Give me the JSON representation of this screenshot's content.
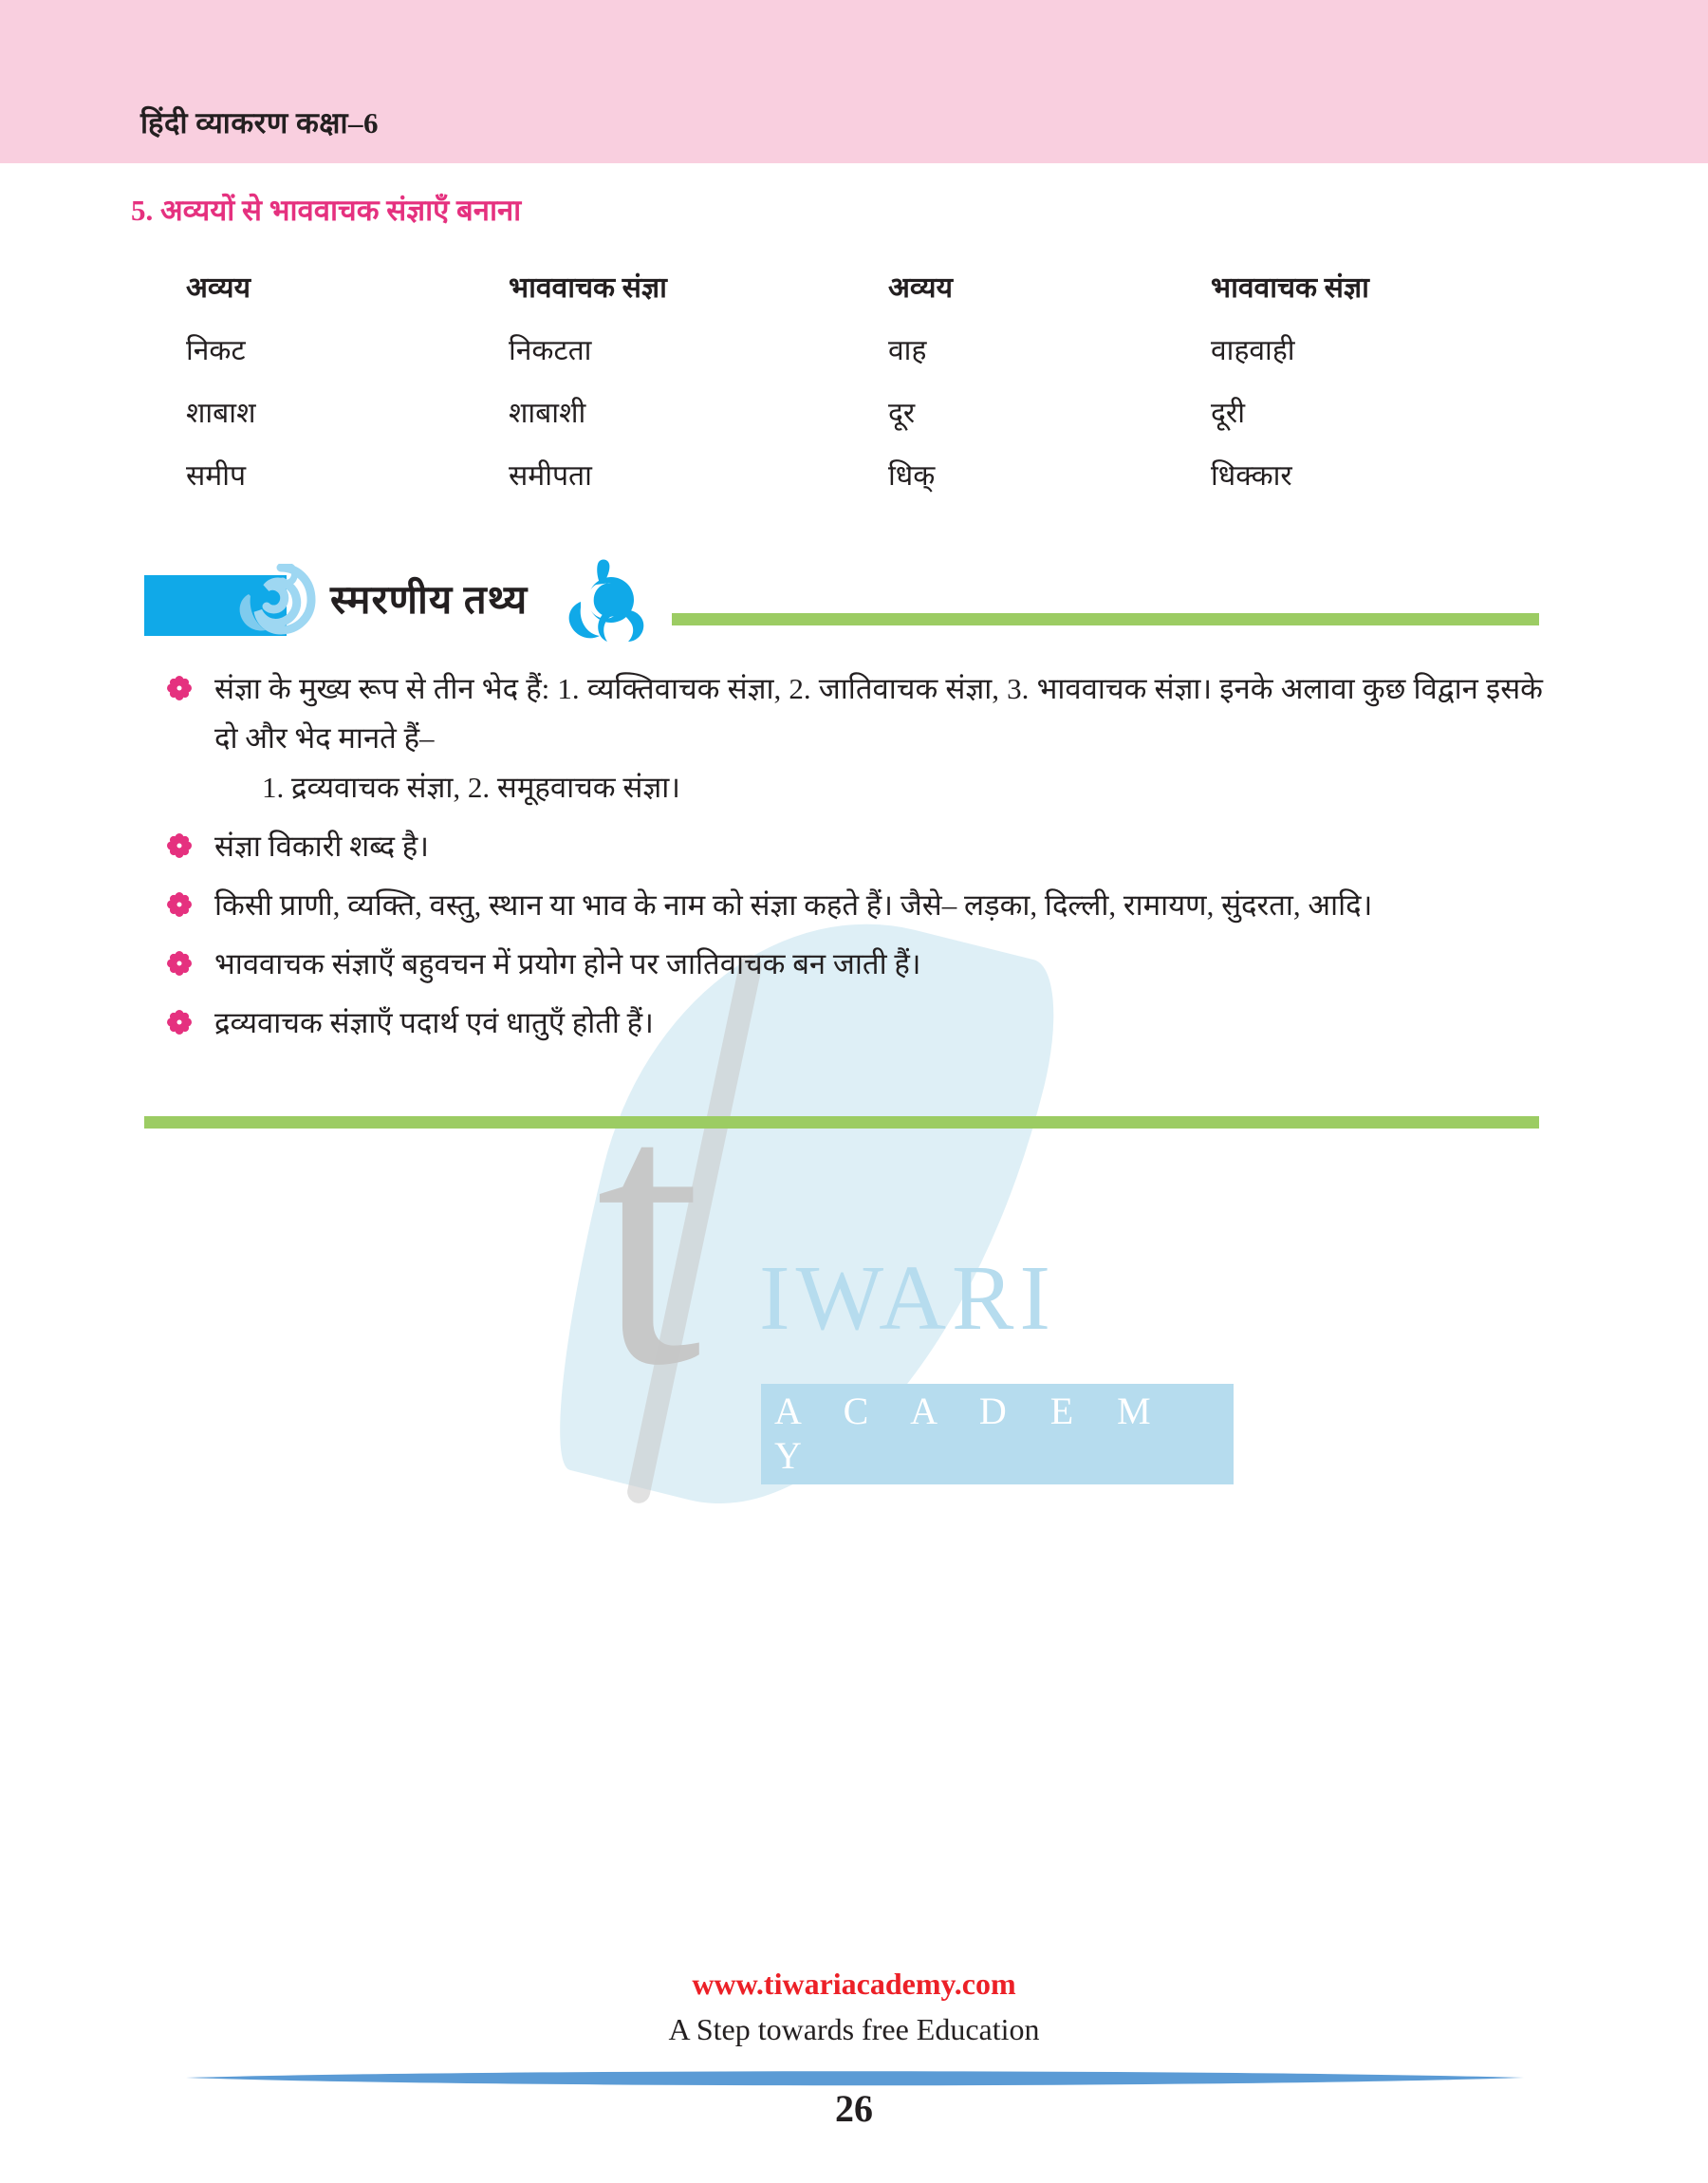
{
  "header": {
    "title": "हिंदी व्याकरण कक्षा–6",
    "background_color": "#f9cfdf"
  },
  "section": {
    "heading": "5. अव्ययों से भाववाचक संज्ञाएँ बनाना",
    "heading_color": "#e5317f"
  },
  "table": {
    "headers": [
      "अव्यय",
      "भाववाचक संज्ञा",
      "अव्यय",
      "भाववाचक संज्ञा"
    ],
    "rows": [
      [
        "निकट",
        "निकटता",
        "वाह",
        "वाहवाही"
      ],
      [
        "शाबाश",
        "शाबाशी",
        "दूर",
        "दूरी"
      ],
      [
        "समीप",
        "समीपता",
        "धिक्",
        "धिक्कार"
      ]
    ]
  },
  "facts": {
    "title": "स्मरणीय तथ्य",
    "accent_blue": "#10a9e8",
    "rule_green": "#9ccc63",
    "bullet_color": "#e5317f",
    "items": [
      {
        "text": "संज्ञा के मुख्य रूप से तीन भेद हैं: 1. व्यक्तिवाचक संज्ञा, 2. जातिवाचक संज्ञा, 3. भाववाचक संज्ञा। इनके अलावा कुछ विद्वान इसके दो और भेद मानते हैं–",
        "sub": "1. द्रव्यवाचक संज्ञा, 2. समूहवाचक संज्ञा।"
      },
      {
        "text": "संज्ञा विकारी शब्द है।",
        "sub": ""
      },
      {
        "text": "किसी प्राणी, व्यक्ति, वस्तु, स्थान या भाव के नाम को संज्ञा कहते हैं। जैसे– लड़का, दिल्ली, रामायण, सुंदरता, आदि।",
        "sub": ""
      },
      {
        "text": "भाववाचक संज्ञाएँ बहुवचन में प्रयोग होने पर जातिवाचक बन जाती हैं।",
        "sub": ""
      },
      {
        "text": "द्रव्यवाचक संज्ञाएँ पदार्थ एवं धातुएँ होती हैं।",
        "sub": ""
      }
    ]
  },
  "watermark": {
    "letter": "t",
    "name": "IWARI",
    "subtitle": "A C A D E M Y",
    "color_text": "#b6dcee",
    "color_letter": "#c6c6c6"
  },
  "footer": {
    "url": "www.tiwariacademy.com",
    "url_color": "#ec2027",
    "tagline": "A Step towards free Education",
    "page_number": "26",
    "swoosh_color": "#5b9bd5"
  }
}
